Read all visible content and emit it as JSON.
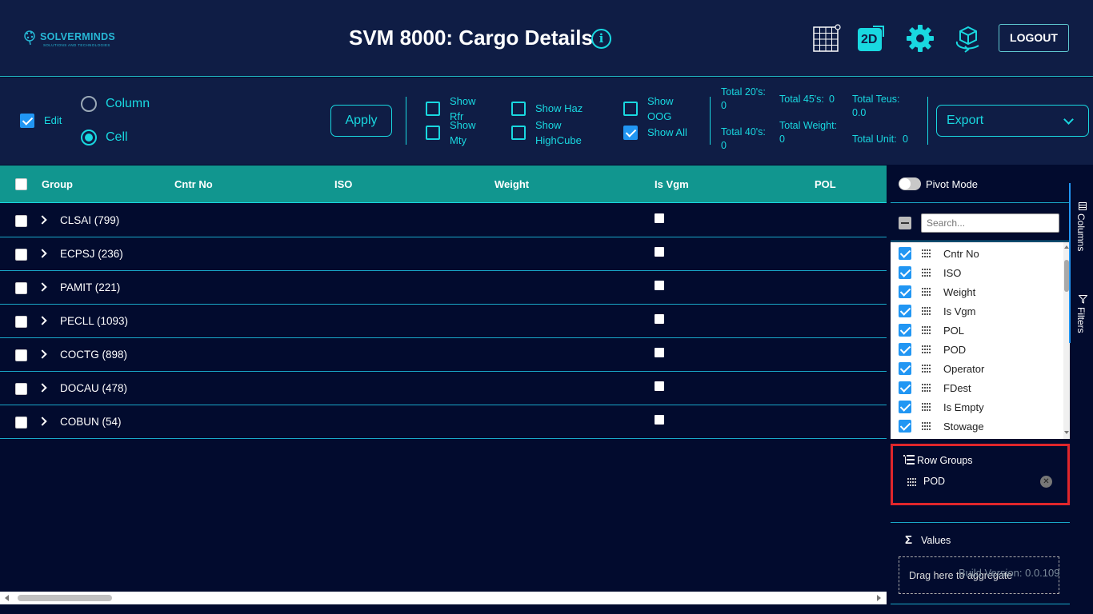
{
  "header": {
    "brand": "SOLVERMINDS",
    "brand_tagline": "SOLUTIONS AND TECHNOLOGIES",
    "title": "SVM 8000: Cargo Details",
    "info_icon": "i",
    "view_2d_label": "2D",
    "logout_label": "LOGOUT",
    "accent_color": "#19d8e0"
  },
  "toolbar": {
    "edit_label": "Edit",
    "edit_checked": true,
    "mode_options": [
      {
        "label": "Column",
        "selected": false
      },
      {
        "label": "Cell",
        "selected": true
      }
    ],
    "apply_label": "Apply",
    "filters": {
      "show_rfr": {
        "label_line1": "Show",
        "label_line2": "Rfr",
        "checked": false
      },
      "show_mty": {
        "label_line1": "Show",
        "label_line2": "Mty",
        "checked": false
      },
      "show_haz": {
        "label": "Show Haz",
        "checked": false
      },
      "show_highcube": {
        "label_line1": "Show",
        "label_line2": "HighCube",
        "checked": false
      },
      "show_oog": {
        "label_line1": "Show",
        "label_line2": "OOG",
        "checked": false
      },
      "show_all": {
        "label": "Show All",
        "checked": true
      }
    },
    "totals": {
      "total_20": {
        "label": "Total 20's:",
        "value": "0"
      },
      "total_40": {
        "label": "Total 40's:",
        "value": "0"
      },
      "total_45": {
        "label": "Total 45's:",
        "value": "0"
      },
      "total_weight": {
        "label": "Total Weight:",
        "value": "0"
      },
      "total_teus": {
        "label": "Total Teus:",
        "value": "0.0"
      },
      "total_unit": {
        "label": "Total Unit:",
        "value": "0"
      }
    },
    "export_label": "Export"
  },
  "grid": {
    "columns": [
      "Group",
      "Cntr No",
      "ISO",
      "Weight",
      "Is Vgm",
      "POL"
    ],
    "rows": [
      {
        "group": "CLSAI (799)"
      },
      {
        "group": "ECPSJ (236)"
      },
      {
        "group": "PAMIT (221)"
      },
      {
        "group": "PECLL (1093)"
      },
      {
        "group": "COCTG (898)"
      },
      {
        "group": "DOCAU (478)"
      },
      {
        "group": "COBUN (54)"
      }
    ]
  },
  "side_panel": {
    "pivot_mode_label": "Pivot Mode",
    "pivot_mode_on": false,
    "search_placeholder": "Search...",
    "columns": [
      {
        "label": "Cntr No",
        "checked": true
      },
      {
        "label": "ISO",
        "checked": true
      },
      {
        "label": "Weight",
        "checked": true
      },
      {
        "label": "Is Vgm",
        "checked": true
      },
      {
        "label": "POL",
        "checked": true
      },
      {
        "label": "POD",
        "checked": true
      },
      {
        "label": "Operator",
        "checked": true
      },
      {
        "label": "FDest",
        "checked": true
      },
      {
        "label": "Is Empty",
        "checked": true
      },
      {
        "label": "Stowage",
        "checked": true
      }
    ],
    "row_groups_title": "Row Groups",
    "row_group_items": [
      "POD"
    ],
    "values_title": "Values",
    "values_drop_text": "Drag here to aggregate",
    "build_version": "Build Version: 0.0.109",
    "tabs": [
      "Columns",
      "Filters"
    ]
  }
}
